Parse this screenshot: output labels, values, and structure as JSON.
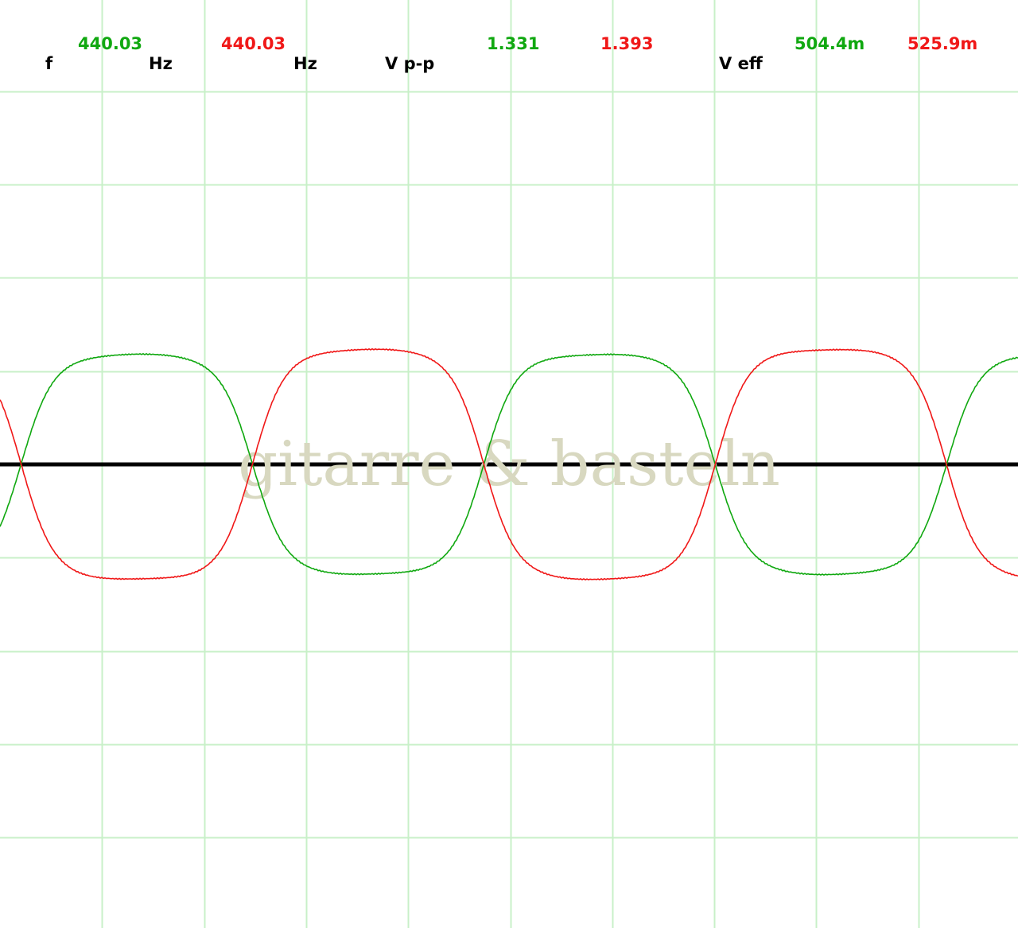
{
  "readouts": {
    "f_label": "f",
    "freq_ch1": "440.03",
    "freq_unit_1": "Hz",
    "freq_ch2": "440.03",
    "freq_unit_2": "Hz",
    "vpp_label": "V p-p",
    "vpp_ch1": "1.331",
    "vpp_ch2": "1.393",
    "veff_label": "V eff",
    "veff_ch1": "504.4m",
    "veff_ch2": "525.9m"
  },
  "watermark": "gitarre & basteln",
  "colors": {
    "ch1": "#10a810",
    "ch2": "#f01818",
    "grid": "#c8f0c8",
    "zero_line": "#000000",
    "background": "#ffffff"
  },
  "chart_data": {
    "type": "line",
    "grid": true,
    "divisions": {
      "x": 10,
      "y": 9
    },
    "series": [
      {
        "channel": "ch1",
        "color": "#10a810",
        "frequency_hz": 440.03,
        "vpp": 1.331,
        "veff": "504.4m",
        "amplitude_div": 2.65,
        "cycles_visible": 2.2,
        "phase_deg": 90,
        "shape": "rounded-square"
      },
      {
        "channel": "ch2",
        "color": "#f01818",
        "frequency_hz": 440.03,
        "vpp": 1.393,
        "veff": "525.9m",
        "amplitude_div": 2.77,
        "cycles_visible": 2.2,
        "phase_deg": -90,
        "shape": "rounded-square"
      }
    ]
  }
}
